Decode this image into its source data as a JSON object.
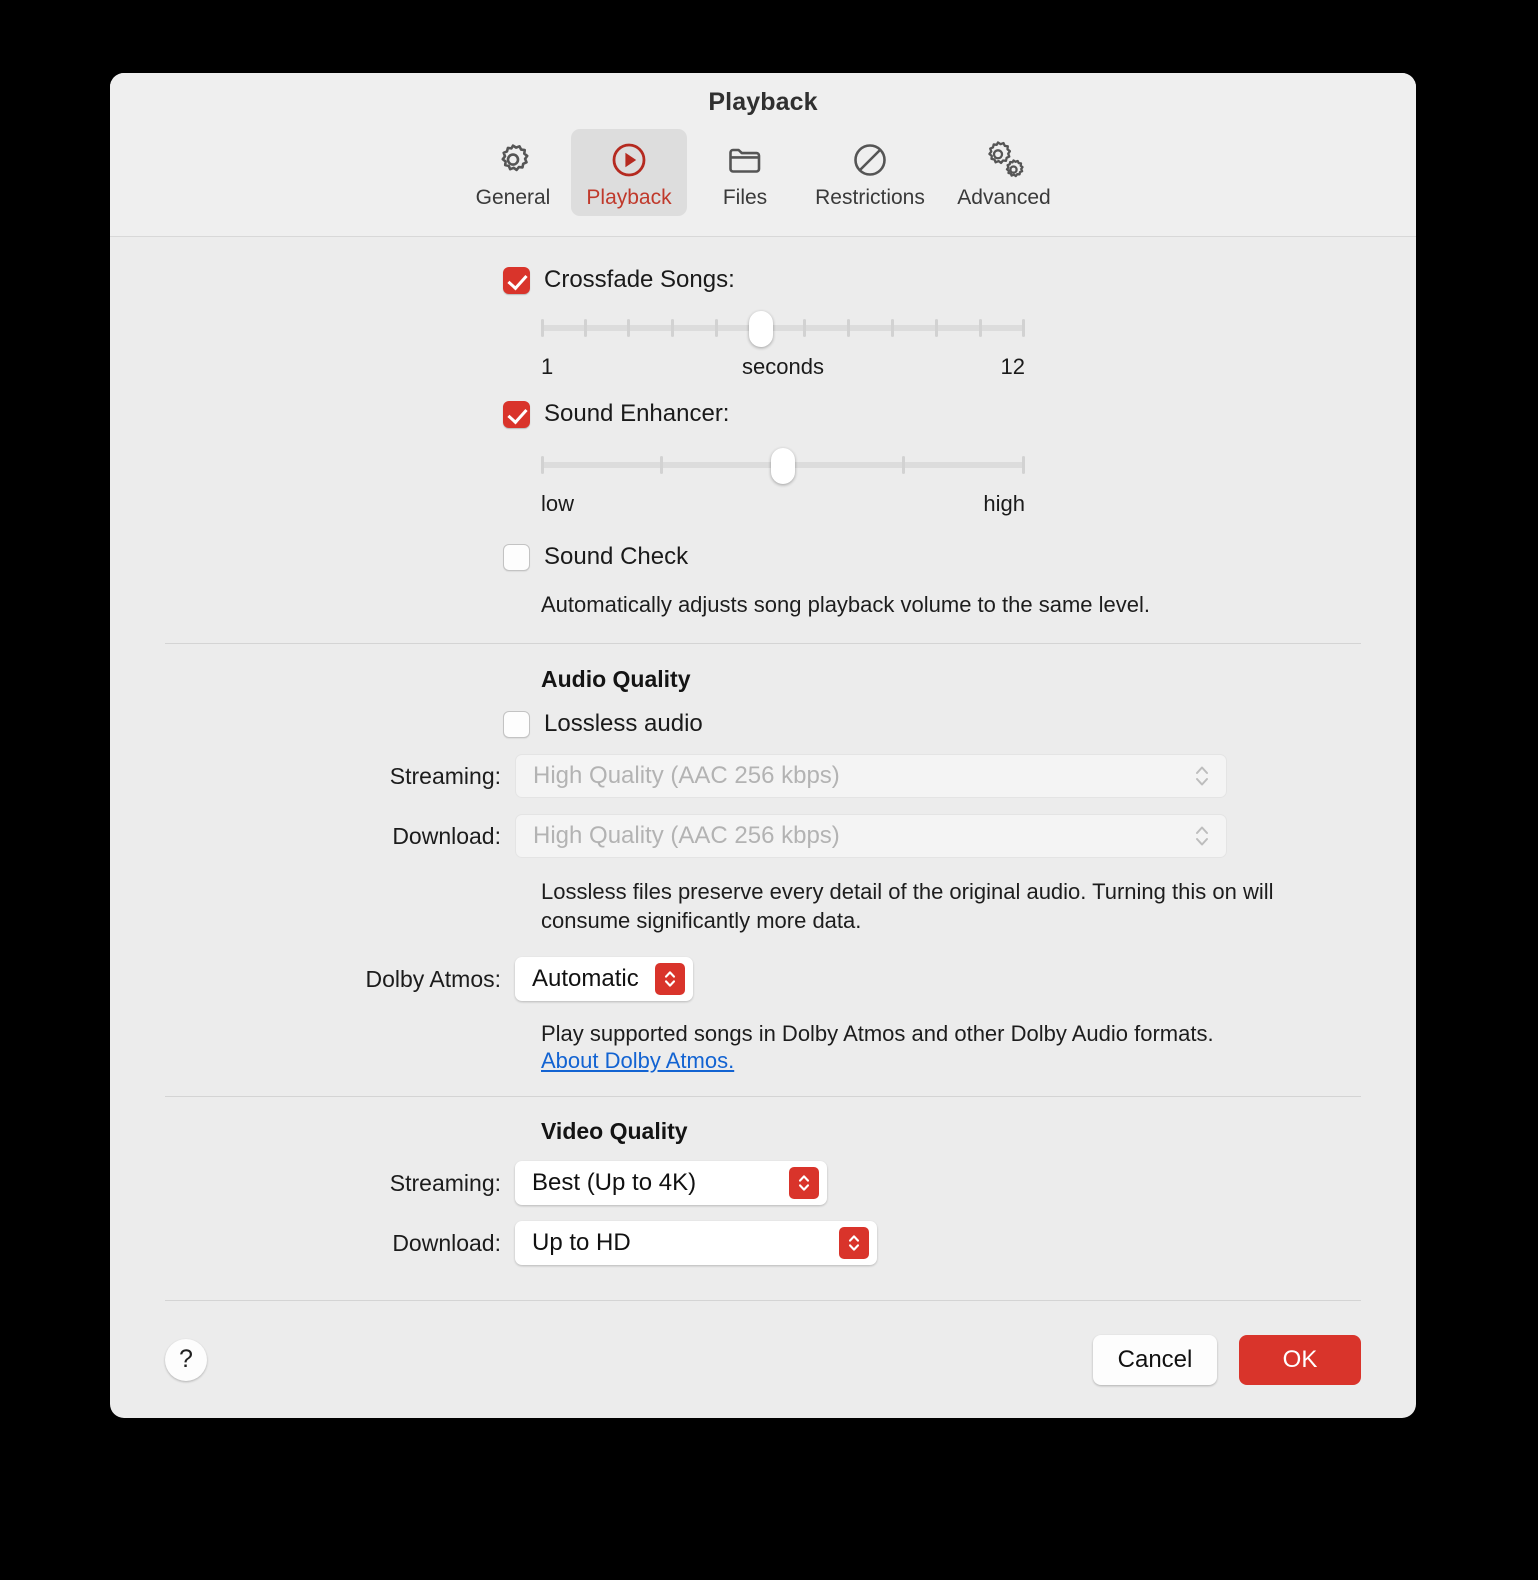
{
  "window": {
    "title": "Playback"
  },
  "toolbar": {
    "tabs": [
      {
        "id": "general",
        "label": "General",
        "icon": "gear-icon",
        "selected": false
      },
      {
        "id": "playback",
        "label": "Playback",
        "icon": "play-circle-icon",
        "selected": true
      },
      {
        "id": "files",
        "label": "Files",
        "icon": "folder-icon",
        "selected": false
      },
      {
        "id": "restrictions",
        "label": "Restrictions",
        "icon": "no-entry-icon",
        "selected": false
      },
      {
        "id": "advanced",
        "label": "Advanced",
        "icon": "double-gear-icon",
        "selected": false
      }
    ]
  },
  "playback": {
    "crossfade": {
      "label": "Crossfade Songs:",
      "checked": true,
      "slider": {
        "min_label": "1",
        "mid_label": "seconds",
        "max_label": "12",
        "min": 1,
        "max": 12,
        "value": 6,
        "ticks": 12
      }
    },
    "sound_enhancer": {
      "label": "Sound Enhancer:",
      "checked": true,
      "slider": {
        "min_label": "low",
        "max_label": "high",
        "min": 0,
        "max": 4,
        "value": 2,
        "ticks": 5
      }
    },
    "sound_check": {
      "label": "Sound Check",
      "checked": false,
      "description": "Automatically adjusts song playback volume to the same level."
    }
  },
  "audio_quality": {
    "heading": "Audio Quality",
    "lossless": {
      "label": "Lossless audio",
      "checked": false
    },
    "streaming": {
      "label": "Streaming:",
      "value": "High Quality (AAC 256 kbps)",
      "disabled": true
    },
    "download": {
      "label": "Download:",
      "value": "High Quality (AAC 256 kbps)",
      "disabled": true
    },
    "lossless_description": "Lossless files preserve every detail of the original audio. Turning this on will consume significantly more data.",
    "dolby_atmos": {
      "label": "Dolby Atmos:",
      "value": "Automatic",
      "description": "Play supported songs in Dolby Atmos and other Dolby Audio formats.",
      "link": "About Dolby Atmos."
    }
  },
  "video_quality": {
    "heading": "Video Quality",
    "streaming": {
      "label": "Streaming:",
      "value": "Best (Up to 4K)"
    },
    "download": {
      "label": "Download:",
      "value": "Up to HD"
    }
  },
  "footer": {
    "help_label": "?",
    "cancel_label": "Cancel",
    "ok_label": "OK"
  },
  "colors": {
    "accent": "#d9342b",
    "link": "#1263d2",
    "dialog_bg": "#ececec"
  }
}
